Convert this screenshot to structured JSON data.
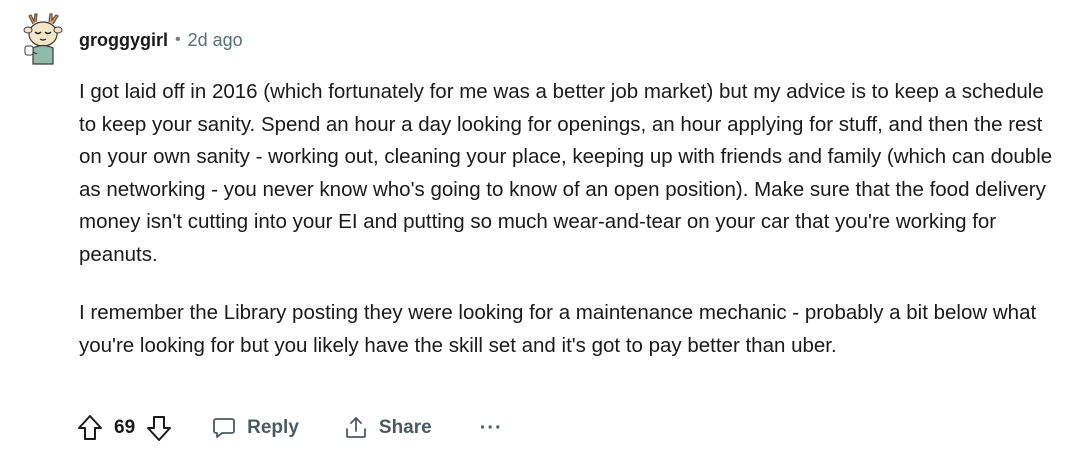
{
  "comment": {
    "username": "groggygirl",
    "separator": "•",
    "timestamp": "2d ago",
    "paragraphs": [
      "I got laid off in 2016 (which fortunately for me was a better job market) but my advice is to keep a schedule to keep your sanity. Spend an hour a day looking for openings, an hour applying for stuff, and then the rest on your own sanity - working out, cleaning your place, keeping up with friends and family (which can double as networking - you never know who's going to know of an open position). Make sure that the food delivery money isn't cutting into your EI and putting so much wear-and-tear on your car that you're working for peanuts.",
      "I remember the Library posting they were looking for a maintenance mechanic - probably a bit below what you're looking for but you likely have the skill set and it's got to pay better than uber."
    ]
  },
  "actions": {
    "vote_count": "69",
    "reply_label": "Reply",
    "share_label": "Share",
    "more_label": "···"
  },
  "icons": {
    "avatar": "snoo-avatar",
    "upvote": "upvote-arrow-icon",
    "downvote": "downvote-arrow-icon",
    "reply": "speech-bubble-icon",
    "share": "share-arrow-icon",
    "more": "ellipsis-icon"
  },
  "colors": {
    "text": "#1a1a1b",
    "muted": "#576f76",
    "action": "#4b5a61",
    "avatar_green": "#8fb9a8"
  }
}
